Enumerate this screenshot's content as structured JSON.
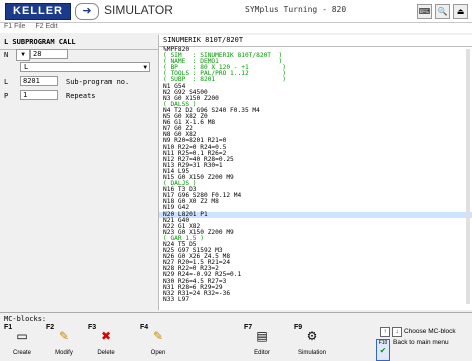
{
  "header": {
    "logo_text": "KELLER",
    "sim_label": "SIMULATOR",
    "app_title": "SYMplus Turning - 820"
  },
  "menu": {
    "items": [
      "F1 File",
      "F2 Edit"
    ]
  },
  "left_panel": {
    "title": "L SUBPROGRAM CALL",
    "n_label": "N",
    "n_value": "28",
    "l_select": "L",
    "l_label": "L",
    "l_value": "8201",
    "l_unit": "Sub-program no.",
    "p_label": "P",
    "p_value": "1",
    "p_unit": "Repeats"
  },
  "editor": {
    "title": "SINUMERIK 810T/820T",
    "lines": [
      {
        "t": "%MPF820",
        "c": false
      },
      {
        "t": "( SIM   : SINUMERIK 810T/820T  )",
        "c": true
      },
      {
        "t": "( NAME  : DEMO1                )",
        "c": true
      },
      {
        "t": "( BP    : 80 X 120 - +1         )",
        "c": true
      },
      {
        "t": "( TOOLS : PAL/PRO 1..12         )",
        "c": true
      },
      {
        "t": "( SUBP  : 8201                  )",
        "c": true
      },
      {
        "t": "N1 G54",
        "c": false
      },
      {
        "t": "N2 G92 S4500",
        "c": false
      },
      {
        "t": "N3 G0 X150 Z200",
        "c": false
      },
      {
        "t": "( DALSS )",
        "c": true
      },
      {
        "t": "N4 T2 D2 G96 S240 F0.35 M4",
        "c": false
      },
      {
        "t": "N5 G0 X82 Z0",
        "c": false
      },
      {
        "t": "N6 G1 X-1.6 M8",
        "c": false
      },
      {
        "t": "N7 G0 Z2",
        "c": false
      },
      {
        "t": "N8 G0 X82",
        "c": false
      },
      {
        "t": "N9 R20=8201 R21=0",
        "c": false
      },
      {
        "t": "N10 R22=0 R24=0.5",
        "c": false
      },
      {
        "t": "N11 R25=0.1 R26=2",
        "c": false
      },
      {
        "t": "N12 R27=40 R28=0.25",
        "c": false
      },
      {
        "t": "N13 R29=31 R30=1",
        "c": false
      },
      {
        "t": "N14 L95",
        "c": false
      },
      {
        "t": "N15 G0 X150 Z200 M9",
        "c": false
      },
      {
        "t": "( DALJS )",
        "c": true
      },
      {
        "t": "N16 T3 D3",
        "c": false
      },
      {
        "t": "N17 G96 S280 F0.12 M4",
        "c": false
      },
      {
        "t": "N18 G0 X0 Z2 M8",
        "c": false
      },
      {
        "t": "N19 G42",
        "c": false
      },
      {
        "t": "N20 L8201 P1",
        "c": false,
        "hl": true
      },
      {
        "t": "N21 G40",
        "c": false
      },
      {
        "t": "N22 G1 X82",
        "c": false
      },
      {
        "t": "N23 G0 X150 Z200 M9",
        "c": false
      },
      {
        "t": "( GAR_1.5 )",
        "c": true
      },
      {
        "t": "N24 T5 D5",
        "c": false
      },
      {
        "t": "N25 G97 S1592 M3",
        "c": false
      },
      {
        "t": "N26 G0 X26 Z4.5 M8",
        "c": false
      },
      {
        "t": "N27 R20=1.5 R21=24",
        "c": false
      },
      {
        "t": "N28 R22=0 R23=2",
        "c": false
      },
      {
        "t": "N29 R24=-0.92 R25=0.1",
        "c": false
      },
      {
        "t": "N30 R26=4.5 R27=3",
        "c": false
      },
      {
        "t": "N31 R28=6 R29=29",
        "c": false
      },
      {
        "t": "N32 R31=24 R32=-36",
        "c": false
      },
      {
        "t": "N33 L97",
        "c": false
      }
    ]
  },
  "softkeys": {
    "title": "MC-blocks:",
    "keys": [
      {
        "fkey": "F1",
        "label": "Create",
        "icon": "create-icon"
      },
      {
        "fkey": "F2",
        "label": "Modify",
        "icon": "pencil-icon"
      },
      {
        "fkey": "F3",
        "label": "Delete",
        "icon": "delete-icon"
      },
      {
        "fkey": "F4",
        "label": "Open",
        "icon": "open-icon"
      },
      {
        "fkey": "F7",
        "label": "Editor",
        "icon": "editor-icon"
      },
      {
        "fkey": "F9",
        "label": "Simulation",
        "icon": "simulation-icon"
      }
    ],
    "choose_label": "Choose MC-block",
    "back_label": "Back to main menu",
    "back_fkey": "F10"
  }
}
